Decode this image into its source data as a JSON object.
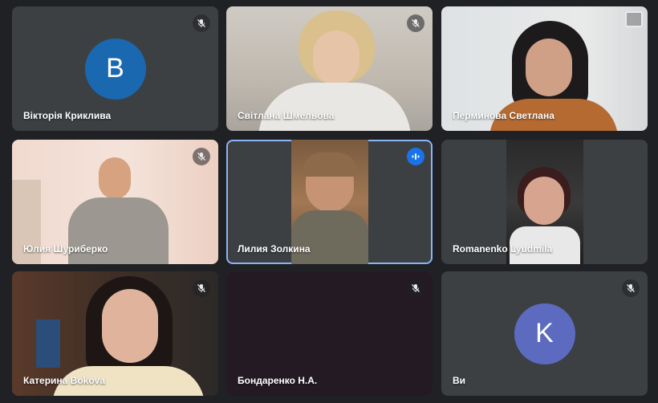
{
  "participants": [
    {
      "name": "Вікторія Криклива",
      "avatar_letter": "B",
      "avatar_color": "#1a68b0",
      "muted": true
    },
    {
      "name": "Світлана Шмельова",
      "muted": true
    },
    {
      "name": "Перминова Светлана",
      "muted": false
    },
    {
      "name": "Юлия Шуриберко",
      "muted": true
    },
    {
      "name": "Лилия Золкина",
      "muted": false,
      "speaking": true
    },
    {
      "name": "Romanenko Lyudmila",
      "muted": false
    },
    {
      "name": "Катерина Bokova",
      "muted": true
    },
    {
      "name": "Бондаренко Н.А.",
      "muted": true
    },
    {
      "name": "Ви",
      "avatar_letter": "K",
      "avatar_color": "#5c6bc0",
      "muted": true
    }
  ],
  "theme": {
    "background": "#202124",
    "tile": "#3c4043",
    "active_border": "#8ab4f8",
    "speaking_badge": "#1a73e8"
  }
}
